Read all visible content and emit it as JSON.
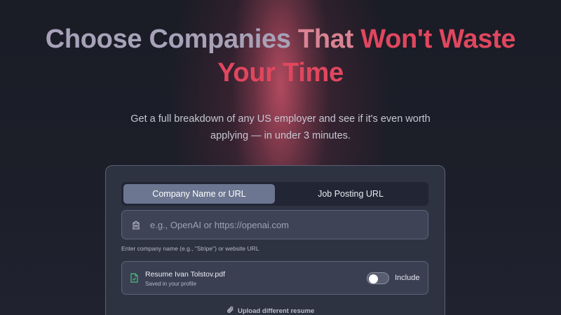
{
  "hero": {
    "title_part1": "Choose Companies ",
    "title_part2": "That ",
    "title_part3": "Won't Waste",
    "title_line2": "Your Time",
    "subtitle_line1": "Get a full breakdown of any US employer and see if it's even worth",
    "subtitle_line2": "applying — in under 3 minutes."
  },
  "tabs": [
    {
      "label": "Company Name or URL",
      "active": true
    },
    {
      "label": "Job Posting URL",
      "active": false
    }
  ],
  "search": {
    "placeholder": "e.g., OpenAI or https://openai.com",
    "value": "",
    "helper": "Enter company name (e.g., \"Stripe\") or website URL"
  },
  "resume": {
    "filename": "Resume Ivan Tolstov.pdf",
    "subtitle": "Saved in your profile",
    "toggle_label": "Include",
    "toggle_on": false
  },
  "upload": {
    "label": "Upload different resume"
  },
  "icons": {
    "input": "building-icon",
    "file": "file-icon",
    "upload": "paperclip-icon"
  },
  "colors": {
    "accent_red": "#e0475e",
    "accent_pink": "#d98393",
    "title_grey": "#a7a2b8",
    "file_icon_green": "#4cc07a"
  }
}
